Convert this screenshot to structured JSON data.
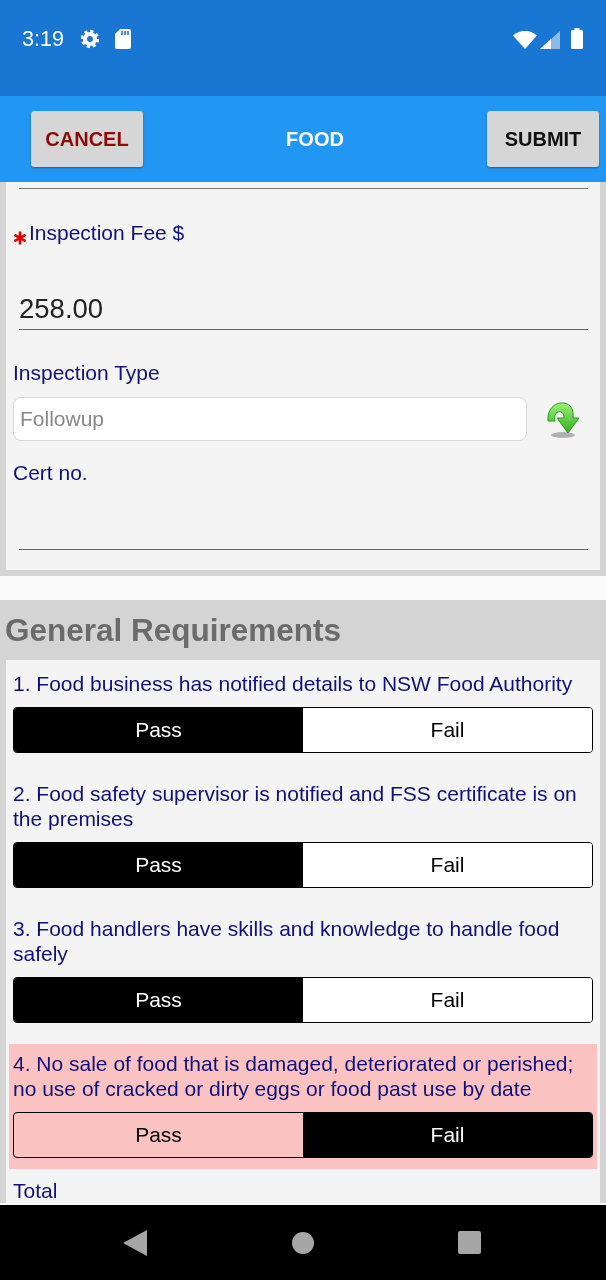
{
  "status_bar": {
    "time": "3:19"
  },
  "app_bar": {
    "cancel": "CANCEL",
    "title": "FOOD",
    "submit": "SUBMIT"
  },
  "form": {
    "fields": [
      {
        "kind": "underline",
        "label": "Inspection Fee $",
        "required": true,
        "value": "258.00"
      },
      {
        "kind": "dropdown",
        "label": "Inspection Type",
        "required": false,
        "placeholder": "Followup"
      },
      {
        "kind": "underline",
        "label": "Cert no.",
        "required": false
      }
    ]
  },
  "section": {
    "title": "General Requirements",
    "items": [
      {
        "text": "1. Food business has notified details to NSW Food Authority",
        "flagged": false,
        "options": [
          {
            "label": "Pass",
            "selected": true
          },
          {
            "label": "Fail",
            "selected": false
          }
        ]
      },
      {
        "text": "2. Food safety supervisor is notified and FSS certificate is on the premises",
        "flagged": false,
        "options": [
          {
            "label": "Pass",
            "selected": true
          },
          {
            "label": "Fail",
            "selected": false
          }
        ]
      },
      {
        "text": "3. Food handlers have skills and knowledge to handle food safely",
        "flagged": false,
        "options": [
          {
            "label": "Pass",
            "selected": true
          },
          {
            "label": "Fail",
            "selected": false
          }
        ]
      },
      {
        "text": "4. No sale of food that is damaged, deteriorated or perished; no use of cracked or dirty eggs or food past use by date",
        "flagged": true,
        "options": [
          {
            "label": "Pass",
            "selected": false
          },
          {
            "label": "Fail",
            "selected": true
          }
        ]
      }
    ],
    "total_label": "Total"
  }
}
